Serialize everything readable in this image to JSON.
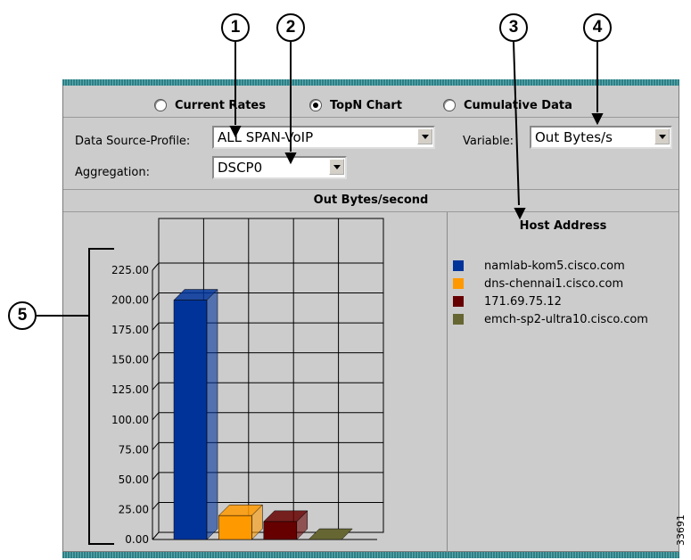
{
  "callouts": [
    "1",
    "2",
    "3",
    "4",
    "5"
  ],
  "view_options": [
    {
      "label": "Current Rates",
      "selected": false
    },
    {
      "label": "TopN Chart",
      "selected": true
    },
    {
      "label": "Cumulative Data",
      "selected": false
    }
  ],
  "controls": {
    "data_source_label": "Data Source-Profile:",
    "data_source_value": "ALL SPAN-VoIP",
    "variable_label": "Variable:",
    "variable_value": "Out Bytes/s",
    "aggregation_label": "Aggregation:",
    "aggregation_value": "DSCP0"
  },
  "chart_header": "Out Bytes/second",
  "legend": {
    "title": "Host Address",
    "items": [
      {
        "label": "namlab-kom5.cisco.com",
        "color": "#003399"
      },
      {
        "label": "dns-chennai1.cisco.com",
        "color": "#ff9900"
      },
      {
        "label": "171.69.75.12",
        "color": "#660000"
      },
      {
        "label": "emch-sp2-ultra10.cisco.com",
        "color": "#666633"
      }
    ]
  },
  "chart_data": {
    "type": "bar",
    "categories": [
      "namlab-kom5.cisco.com",
      "dns-chennai1.cisco.com",
      "171.69.75.12",
      "emch-sp2-ultra10.cisco.com"
    ],
    "values": [
      200,
      20,
      15,
      0
    ],
    "colors": [
      "#003399",
      "#ff9900",
      "#660000",
      "#666633"
    ],
    "ylim": [
      0,
      225
    ],
    "yticks": [
      "0.00",
      "25.00",
      "50.00",
      "75.00",
      "100.00",
      "125.00",
      "150.00",
      "175.00",
      "200.00",
      "225.00"
    ],
    "xlabel": "",
    "ylabel": "",
    "title": "",
    "grid": true,
    "legend_placement": "right"
  },
  "figure_id": "33691"
}
